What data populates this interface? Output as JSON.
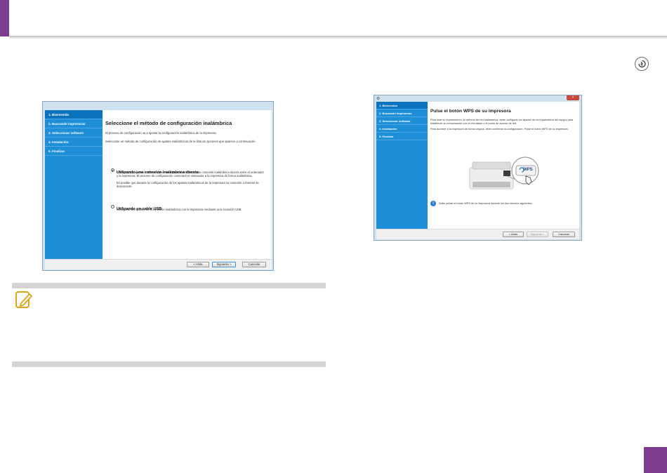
{
  "window1": {
    "sidebar": [
      "1. Bienvenido",
      "2. Buscando impresoras",
      "3. Seleccionar software",
      "4. Instalación",
      "5. Finalizar"
    ],
    "heading": "Seleccione el método de configuración inalámbrica",
    "intro1": "El proceso de configuración va a ajustar la configuración inalámbrica de la impresora.",
    "intro2": "Seleccione un método de configuración de ajustes inalámbricos de la lista de opciones que aparece a continuación.",
    "option1": {
      "title": "Utilizando una conexión inalámbrica directa",
      "desc": "Configura los ajustes inalámbricos de la impresora mediante una conexión inalámbrica directa entre el ordenador y la impresora. El proceso de configuración conectará el ordenador a la impresora de forma inalámbrica.",
      "desc2": "Es posible que durante la configuración de los ajustes inalámbricos de la impresora su conexión a Internet se desconecte."
    },
    "option2": {
      "title": "Utilizando un cable USB",
      "desc": "Configurar los ajustes de la conexión inalámbrica con la impresora mediante una conexión USB"
    },
    "buttons": {
      "back": "< Atrás",
      "next": "Siguiente >",
      "cancel": "Cancelar"
    }
  },
  "window2": {
    "sidebar": [
      "1. Bienvenido",
      "2. Buscando impresoras",
      "3. Seleccionar software",
      "4. Instalación",
      "5. Finalizar"
    ],
    "heading": "Pulse el botón WPS de su impresora",
    "intro1": "Para usar su impresora en un entorno de red inalámbrica, debe configurar los ajustes de red inalámbrica del equipo para establecer la comunicación con el enrutador o el punto de acceso de red.",
    "intro2": "Para acceder a la impresora de forma segura, debe confirmar la configuración. Pulse el botón WPS de su impresora.",
    "wps_label": "WPS",
    "notice": "Debe pulsar el botón WPS de su impresora durante los dos minutos siguientes.",
    "buttons": {
      "back": "< Atrás",
      "next": "Siguiente >",
      "cancel": "Cancelar"
    }
  },
  "colors": {
    "accent": "#7d3c8f",
    "sidebar": "#1e8fd6",
    "note_bar": "#d4d4d4"
  }
}
